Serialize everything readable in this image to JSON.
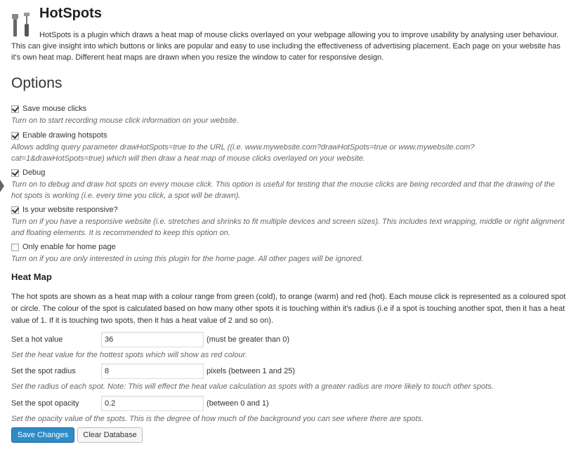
{
  "header": {
    "title": "HotSpots",
    "intro": "HotSpots is a plugin which draws a heat map of mouse clicks overlayed on your webpage allowing you to improve usability by analysing user behaviour. This can give insight into which buttons or links are popular and easy to use including the effectiveness of advertising placement. Each page on your website has it's own heat map. Different heat maps are drawn when you resize the window to cater for responsive design."
  },
  "options": {
    "heading": "Options",
    "items": [
      {
        "label": "Save mouse clicks",
        "checked": true,
        "desc": "Turn on to start recording mouse click information on your website."
      },
      {
        "label": "Enable drawing hotspots",
        "checked": true,
        "desc": "Allows adding query parameter drawHotSpots=true to the URL ((i.e. www.mywebsite.com?drawHotSpots=true or www.mywebsite.com?cat=1&drawHotSpots=true) which will then draw a heat map of mouse clicks overlayed on your website."
      },
      {
        "label": "Debug",
        "checked": true,
        "desc": "Turn on to debug and draw hot spots on every mouse click. This option is useful for testing that the mouse clicks are being recorded and that the drawing of the hot spots is working (i.e. every time you click, a spot will be drawn)."
      },
      {
        "label": "Is your website responsive?",
        "checked": true,
        "desc": "Turn on if you have a responsive website (i.e. stretches and shrinks to fit multiple devices and screen sizes). This includes text wrapping, middle or right alignment and floating elements. It is recommended to keep this option on."
      },
      {
        "label": "Only enable for home page",
        "checked": false,
        "desc": "Turn on if you are only interested in using this plugin for the home page. All other pages will be ignored."
      }
    ]
  },
  "heatmap": {
    "heading": "Heat Map",
    "desc": "The hot spots are shown as a heat map with a colour range from green (cold), to orange (warm) and red (hot). Each mouse click is represented as a coloured spot or circle. The colour of the spot is calculated based on how many other spots it is touching within it's radius (i.e if a spot is touching another spot, then it has a heat value of 1. If it is touching two spots, then it has a heat value of 2 and so on).",
    "fields": [
      {
        "label": "Set a hot value",
        "value": "36",
        "hint": "(must be greater than 0)",
        "desc": "Set the heat value for the hottest spots which will show as red colour."
      },
      {
        "label": "Set the spot radius",
        "value": "8",
        "hint": "pixels (between 1 and 25)",
        "desc": "Set the radius of each spot. Note: This will effect the heat value calculation as spots with a greater radius are more likely to touch other spots."
      },
      {
        "label": "Set the spot opacity",
        "value": "0.2",
        "hint": "(between 0 and 1)",
        "desc": "Set the opacity value of the spots. This is the degree of how much of the background you can see where there are spots."
      }
    ]
  },
  "buttons": {
    "save": "Save Changes",
    "clear": "Clear Database"
  },
  "colors": {
    "primary_button": "#2e8bc6",
    "description_text": "#666666"
  }
}
